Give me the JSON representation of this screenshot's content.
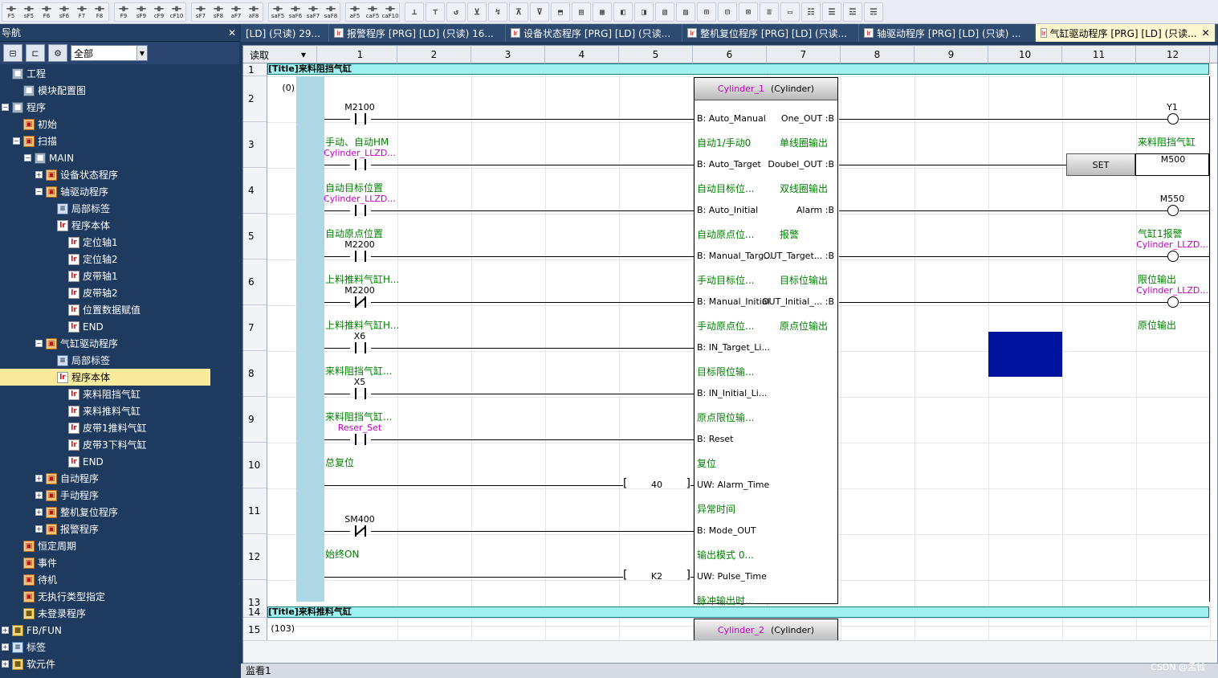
{
  "toolbar": {
    "groups": [
      {
        "items": [
          "F5",
          "sF5",
          "F6",
          "sF6",
          "F7",
          "F8"
        ]
      },
      {
        "items": [
          "F9",
          "sF9",
          "cF9",
          "cF10"
        ]
      },
      {
        "items": [
          "sF7",
          "sF8",
          "aF7",
          "aF8"
        ]
      },
      {
        "items": [
          "saF5",
          "saF6",
          "saF7",
          "saF8"
        ]
      },
      {
        "items": [
          "aF5",
          "caF5",
          "caF10"
        ]
      }
    ]
  },
  "nav": {
    "title": "导航",
    "pin": "ᛘ",
    "close": "✕",
    "filter": "全部",
    "tree": [
      {
        "label": "工程",
        "depth": 0,
        "toggle": "",
        "icon": "proj"
      },
      {
        "label": "模块配置图",
        "depth": 1,
        "toggle": "",
        "icon": "proj"
      },
      {
        "label": "程序",
        "depth": 0,
        "toggle": "−",
        "icon": "proj"
      },
      {
        "label": "初始",
        "depth": 1,
        "toggle": "",
        "icon": "prog"
      },
      {
        "label": "扫描",
        "depth": 1,
        "toggle": "−",
        "icon": "prog"
      },
      {
        "label": "MAIN",
        "depth": 2,
        "toggle": "−",
        "icon": "proj"
      },
      {
        "label": "设备状态程序",
        "depth": 3,
        "toggle": "+",
        "icon": "prog"
      },
      {
        "label": "轴驱动程序",
        "depth": 3,
        "toggle": "−",
        "icon": "prog"
      },
      {
        "label": "局部标签",
        "depth": 4,
        "toggle": "",
        "icon": "lbl"
      },
      {
        "label": "程序本体",
        "depth": 4,
        "toggle": "",
        "icon": "doc"
      },
      {
        "label": "定位轴1",
        "depth": 5,
        "toggle": "",
        "icon": "doc"
      },
      {
        "label": "定位轴2",
        "depth": 5,
        "toggle": "",
        "icon": "doc"
      },
      {
        "label": "皮带轴1",
        "depth": 5,
        "toggle": "",
        "icon": "doc"
      },
      {
        "label": "皮带轴2",
        "depth": 5,
        "toggle": "",
        "icon": "doc"
      },
      {
        "label": "位置数据赋值",
        "depth": 5,
        "toggle": "",
        "icon": "doc"
      },
      {
        "label": "END",
        "depth": 5,
        "toggle": "",
        "icon": "doc"
      },
      {
        "label": "气缸驱动程序",
        "depth": 3,
        "toggle": "−",
        "icon": "prog"
      },
      {
        "label": "局部标签",
        "depth": 4,
        "toggle": "",
        "icon": "lbl"
      },
      {
        "label": "程序本体",
        "depth": 4,
        "toggle": "",
        "icon": "doc",
        "selected": true
      },
      {
        "label": "来料阻挡气缸",
        "depth": 5,
        "toggle": "",
        "icon": "doc"
      },
      {
        "label": "来料推料气缸",
        "depth": 5,
        "toggle": "",
        "icon": "doc"
      },
      {
        "label": "皮带1推料气缸",
        "depth": 5,
        "toggle": "",
        "icon": "doc"
      },
      {
        "label": "皮带3下料气缸",
        "depth": 5,
        "toggle": "",
        "icon": "doc"
      },
      {
        "label": "END",
        "depth": 5,
        "toggle": "",
        "icon": "doc"
      },
      {
        "label": "自动程序",
        "depth": 3,
        "toggle": "+",
        "icon": "prog"
      },
      {
        "label": "手动程序",
        "depth": 3,
        "toggle": "+",
        "icon": "prog"
      },
      {
        "label": "整机复位程序",
        "depth": 3,
        "toggle": "+",
        "icon": "prog"
      },
      {
        "label": "报警程序",
        "depth": 3,
        "toggle": "+",
        "icon": "prog"
      },
      {
        "label": "恒定周期",
        "depth": 1,
        "toggle": "",
        "icon": "prog"
      },
      {
        "label": "事件",
        "depth": 1,
        "toggle": "",
        "icon": "prog"
      },
      {
        "label": "待机",
        "depth": 1,
        "toggle": "",
        "icon": "prog"
      },
      {
        "label": "无执行类型指定",
        "depth": 1,
        "toggle": "",
        "icon": "prog"
      },
      {
        "label": "未登录程序",
        "depth": 1,
        "toggle": "",
        "icon": "fold"
      },
      {
        "label": "FB/FUN",
        "depth": 0,
        "toggle": "+",
        "icon": "fold"
      },
      {
        "label": "标签",
        "depth": 0,
        "toggle": "+",
        "icon": "lbl"
      },
      {
        "label": "软元件",
        "depth": 0,
        "toggle": "+",
        "icon": "fold"
      }
    ]
  },
  "tabs": [
    {
      "label": "[LD] (只读) 29...",
      "icon": false,
      "width": 110
    },
    {
      "label": "报警程序 [PRG] [LD] (只读) 16...",
      "icon": true,
      "width": 220
    },
    {
      "label": "设备状态程序 [PRG] [LD] (只读...",
      "icon": true,
      "width": 220
    },
    {
      "label": "整机复位程序 [PRG] [LD] (只读...",
      "icon": true,
      "width": 220
    },
    {
      "label": "轴驱动程序 [PRG] [LD] (只读) ...",
      "icon": true,
      "width": 220
    },
    {
      "label": "气缸驱动程序 [PRG] [LD] (只读...",
      "icon": true,
      "active": true,
      "width": 224
    }
  ],
  "editor": {
    "mode_label": "读取",
    "columns": [
      "1",
      "2",
      "3",
      "4",
      "5",
      "6",
      "7",
      "8",
      "9",
      "10",
      "11",
      "12"
    ],
    "rows": [
      "1",
      "2",
      "3",
      "4",
      "5",
      "6",
      "7",
      "8",
      "9",
      "10",
      "11",
      "12",
      "13",
      "14",
      "15"
    ],
    "steps": {
      "row2": "(0)",
      "row15": "(103)"
    },
    "titles": [
      "[Title]来料阻挡气缸",
      "[Title]来料推料气缸"
    ],
    "fb1": {
      "instance": "Cylinder_1",
      "type": "(Cylinder)"
    },
    "fb2": {
      "instance": "Cylinder_2",
      "type": "(Cylinder)"
    },
    "inputs": [
      {
        "dev": "M2100",
        "cmt": "手动、自动HM",
        "pin": "B: Auto_Manual",
        "pincmt": "自动1/手动0",
        "nc": false,
        "magenta": false
      },
      {
        "dev": "Cylinder_LLZD...",
        "cmt": "自动目标位置",
        "pin": "B: Auto_Target",
        "pincmt": "自动目标位...",
        "nc": false,
        "magenta": true
      },
      {
        "dev": "Cylinder_LLZD...",
        "cmt": "自动原点位置",
        "pin": "B: Auto_Initial",
        "pincmt": "自动原点位...",
        "nc": false,
        "magenta": true
      },
      {
        "dev": "M2200",
        "cmt": "上料推料气缸H...",
        "pin": "B: Manual_Targ...",
        "pincmt": "手动目标位...",
        "nc": false,
        "magenta": false
      },
      {
        "dev": "M2200",
        "cmt": "上料推料气缸H...",
        "pin": "B: Manual_Initial",
        "pincmt": "手动原点位...",
        "nc": true,
        "magenta": false
      },
      {
        "dev": "X6",
        "cmt": "来料阻挡气缸...",
        "pin": "B: IN_Target_Li...",
        "pincmt": "目标限位输...",
        "nc": false,
        "magenta": false
      },
      {
        "dev": "X5",
        "cmt": "来料阻挡气缸...",
        "pin": "B: IN_Initial_Li...",
        "pincmt": "原点限位输...",
        "nc": false,
        "magenta": false
      },
      {
        "dev": "Reser_Set",
        "cmt": "总复位",
        "pin": "B: Reset",
        "pincmt": "复位",
        "nc": false,
        "magenta": true
      },
      {
        "dev": "",
        "cmt": "",
        "pin": "UW: Alarm_Time",
        "pincmt": "异常时间",
        "const": "40"
      },
      {
        "dev": "SM400",
        "cmt": "始终ON",
        "pin": "B: Mode_OUT",
        "pincmt": "输出模式 0...",
        "nc": true,
        "magenta": false
      },
      {
        "dev": "",
        "cmt": "",
        "pin": "UW: Pulse_Time",
        "pincmt": "脉冲输出时...",
        "const": "K2"
      }
    ],
    "outputs": [
      {
        "pin": "One_OUT :B",
        "pincmt": "单线圈输出",
        "coil": "Y1",
        "coilcmt": "来料阻挡气缸",
        "magenta": false
      },
      {
        "pin": "Doubel_OUT :B",
        "pincmt": "双线圈输出",
        "set": "SET",
        "setdev": "M500"
      },
      {
        "pin": "Alarm :B",
        "pincmt": "报警",
        "coil": "M550",
        "coilcmt": "气缸1报警",
        "magenta": false
      },
      {
        "pin": "OUT_Target... :B",
        "pincmt": "目标位输出",
        "coil": "Cylinder_LLZD...",
        "coilcmt": "限位输出",
        "magenta": true
      },
      {
        "pin": "OUT_Initial_... :B",
        "pincmt": "原点位输出",
        "coil": "Cylinder_LLZD...",
        "coilcmt": "原位输出",
        "magenta": true
      }
    ]
  },
  "status": {
    "text": "监看1"
  },
  "watermark": "CSDN @孟钺",
  "colors": {
    "rail": "#add8e6",
    "title_bg": "#9ff2ef",
    "comment": "#008000",
    "device_magenta": "#c000c0",
    "selection": "#00139e",
    "nav_bg": "#1e3a5f"
  }
}
